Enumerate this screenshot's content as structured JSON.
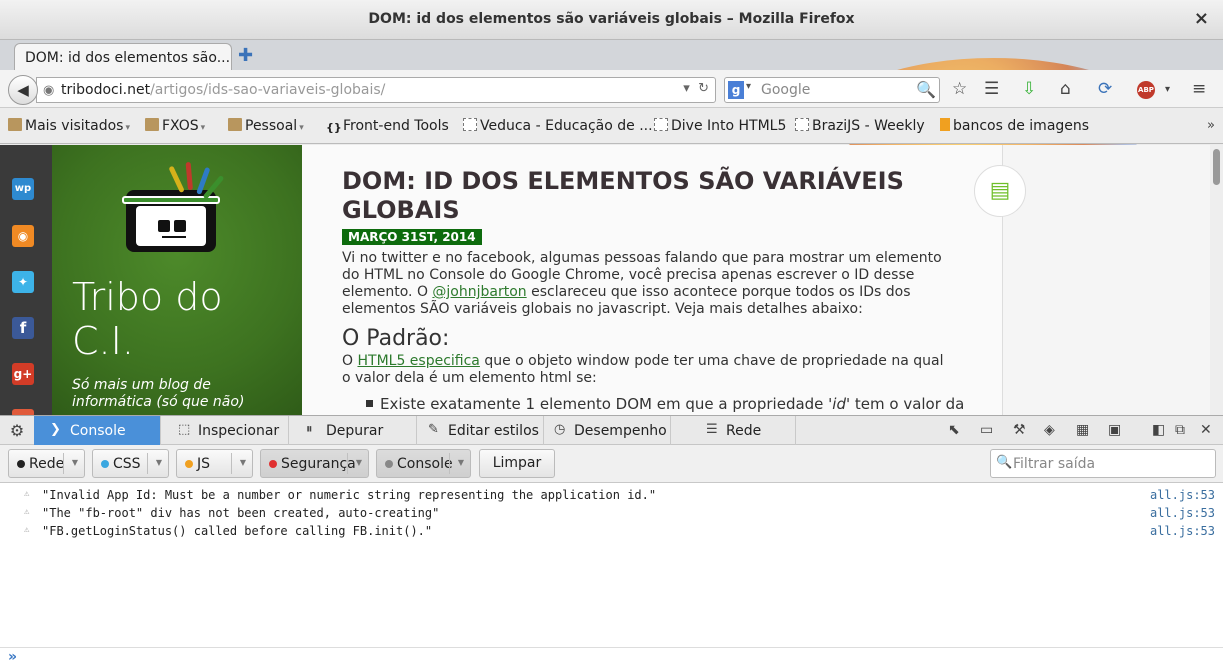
{
  "window": {
    "title": "DOM: id dos elementos são variáveis globais – Mozilla Firefox",
    "close": "×"
  },
  "tabs": [
    {
      "label": "DOM: id dos elementos são..."
    }
  ],
  "newtab": "✚",
  "nav": {
    "back": "◀",
    "url_domain": "tribodoci.net",
    "url_path": "/artigos/ids-sao-variaveis-globais/",
    "search_engine": "g",
    "search_placeholder": "Google",
    "icons": [
      "star-icon",
      "bookmarks-list-icon",
      "download-icon",
      "home-icon",
      "sync-icon",
      "adblock-icon",
      "menu-icon"
    ]
  },
  "bookmarks": [
    {
      "label": "Mais visitados",
      "type": "folder",
      "dropdown": true
    },
    {
      "label": "FXOS",
      "type": "folder",
      "dropdown": true
    },
    {
      "label": "Pessoal",
      "type": "folder",
      "dropdown": true
    },
    {
      "label": "Front-end Tools",
      "type": "page"
    },
    {
      "label": "Veduca - Educação de ...",
      "type": "page"
    },
    {
      "label": "Dive Into HTML5",
      "type": "page"
    },
    {
      "label": "BraziJS - Weekly",
      "type": "page"
    },
    {
      "label": "bancos de imagens",
      "type": "page"
    }
  ],
  "blog": {
    "title": "Tribo do C.I.",
    "subtitle": "Só mais um blog de informática (só que não)",
    "social": [
      "wp",
      "rss",
      "twitter",
      "facebook",
      "gplus"
    ]
  },
  "article": {
    "heading": "DOM: ID DOS ELEMENTOS SÃO VARIÁVEIS GLOBAIS",
    "date": "MARÇO 31ST, 2014",
    "p1_a": "Vi no twitter e no facebook, algumas pessoas falando que para mostrar um elemento do HTML no Console do Google Chrome, você precisa apenas escrever o ID desse elemento. O ",
    "p1_link": "@johnjbarton",
    "p1_b": " esclareceu que isso acontece porque todos os IDs dos elementos SÃO variáveis globais no javascript. Veja mais detalhes abaixo:",
    "h2": "O Padrão:",
    "p2_a": "O ",
    "p2_link": "HTML5 especifica",
    "p2_b": " que o objeto window pode ter uma chave de propriedade na qual o valor dela é um elemento html se:",
    "li_a": "Existe exatamente 1 elemento DOM em que a propriedade ",
    "li_em": "'id'",
    "li_b": " tem o valor da"
  },
  "devtools": {
    "tabs": [
      {
        "label": "Console",
        "active": true
      },
      {
        "label": "Inspecionar",
        "active": false
      },
      {
        "label": "Depurar",
        "active": false
      },
      {
        "label": "Editar estilos",
        "active": false
      },
      {
        "label": "Desempenho",
        "active": false
      },
      {
        "label": "Rede",
        "active": false
      }
    ],
    "filters": [
      {
        "label": "Rede",
        "color": "#222222",
        "pressed": false
      },
      {
        "label": "CSS",
        "color": "#3aa7e0",
        "pressed": false
      },
      {
        "label": "JS",
        "color": "#f0a020",
        "pressed": false
      },
      {
        "label": "Segurança",
        "color": "#e03030",
        "pressed": true
      },
      {
        "label": "Console",
        "color": "#888888",
        "pressed": true
      }
    ],
    "clear_label": "Limpar",
    "filter_placeholder": "Filtrar saída",
    "messages": [
      {
        "text": "\"Invalid App Id: Must be a number or numeric string representing the application id.\"",
        "location": "all.js:53"
      },
      {
        "text": "\"The \"fb-root\" div has not been created, auto-creating\"",
        "location": "all.js:53"
      },
      {
        "text": "\"FB.getLoginStatus() called before calling FB.init().\"",
        "location": "all.js:53"
      }
    ],
    "prompt": "»"
  }
}
